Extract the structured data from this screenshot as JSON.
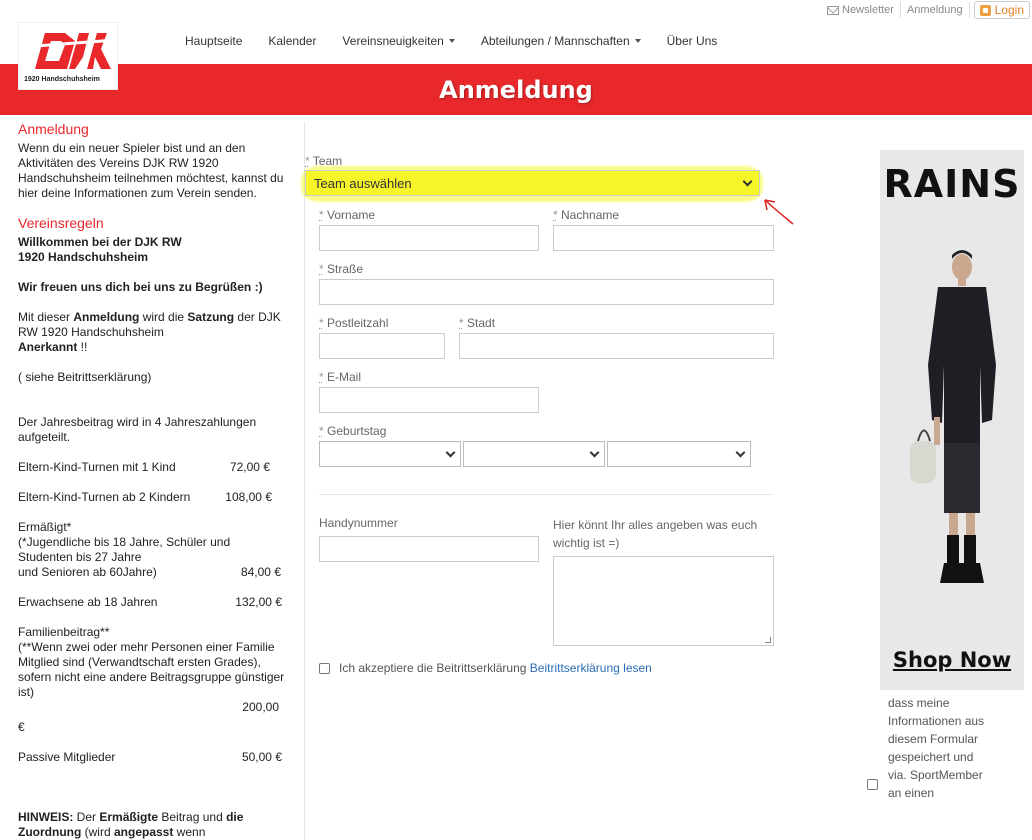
{
  "utility": {
    "newsletter": "Newsletter",
    "anmeldung": "Anmeldung",
    "login": "Login"
  },
  "logo": {
    "mark": "DJK",
    "subtitle": "1920 Handschuhsheim",
    "color": "#e8282b"
  },
  "nav": [
    {
      "label": "Hauptseite",
      "dropdown": false
    },
    {
      "label": "Kalender",
      "dropdown": false
    },
    {
      "label": "Vereinsneuigkeiten",
      "dropdown": true
    },
    {
      "label": "Abteilungen / Mannschaften",
      "dropdown": true
    },
    {
      "label": "Über Uns",
      "dropdown": false
    }
  ],
  "banner": {
    "title": "Anmeldung",
    "color": "#e8282b"
  },
  "left": {
    "heading1": "Anmeldung",
    "intro": "Wenn du ein neuer Spieler bist und an den Aktivitäten des Vereins DJK RW 1920 Handschuhsheim teilnehmen möchtest, kannst du hier deine Informationen zum Verein senden.",
    "heading2": "Vereinsregeln",
    "welcome": "Willkommen bei der DJK RW 1920 Handschuhsheim",
    "greeting": "Wir freuen uns dich bei uns zu Begrüßen :)",
    "rules_pre": "Mit dieser ",
    "rules_b1": "Anmeldung",
    "rules_mid": " wird die ",
    "rules_b2": "Satzung",
    "rules_post": " der DJK RW 1920 Handschuhsheim",
    "rules_b3": "Anerkannt",
    "rules_end": " !!",
    "note": "( siehe Beitrittserklärung)",
    "fee_intro": "Der Jahresbeitrag wird in 4 Jahreszahlungen aufgeteilt.",
    "fee1_label": "Eltern-Kind-Turnen mit 1 Kind",
    "fee1_value": "72,00 €",
    "fee2_label": "Eltern-Kind-Turnen ab 2 Kindern",
    "fee2_value": "108,00 €",
    "fee3_title": "Ermäßigt*",
    "fee3_desc": "(*Jugendliche bis 18 Jahre, Schüler und Studenten bis 27 Jahre",
    "fee3_label": "und Senioren ab 60Jahre)",
    "fee3_value": "84,00 €",
    "fee4_label": "Erwachsene ab 18 Jahren",
    "fee4_value": "132,00 €",
    "fee5_title": "Familienbeitrag**",
    "fee5_desc": "(**Wenn zwei oder mehr Personen einer Familie Mitglied sind (Verwandtschaft ersten Grades), sofern nicht eine andere Beitragsgruppe günstiger ist)",
    "fee5_value": "200,00",
    "fee5_currency": "€",
    "fee6_label": "Passive Mitglieder",
    "fee6_value": "50,00 €",
    "hinweis_b": "HINWEIS:",
    "hinweis_1": " Der ",
    "hinweis_b2": "Ermäßigte",
    "hinweis_2": " Beitrag und ",
    "hinweis_b3": "die",
    "hinweis_b4": "Zuordnung",
    "hinweis_3": " (wird ",
    "hinweis_b5": "angepasst",
    "hinweis_4": " wenn"
  },
  "form": {
    "req": "*",
    "team_label": "Team",
    "team_value": "Team auswählen",
    "vorname": "Vorname",
    "nachname": "Nachname",
    "strasse": "Straße",
    "plz": "Postleitzahl",
    "stadt": "Stadt",
    "email": "E-Mail",
    "geburtstag": "Geburtstag",
    "handy": "Handynummer",
    "notes": "Hier könnt Ihr alles angeben was euch wichtig ist =)",
    "accept_text": "Ich akzeptiere die Beitrittserklärung",
    "accept_link": "Beitrittserklärung lesen",
    "highlight_color": "#f5f52a",
    "link_color": "#2a6db5"
  },
  "ad": {
    "brand": "RAINS",
    "cta": "Shop Now"
  },
  "right_text": "dass meine Informationen aus diesem Formular gespeichert und via. SportMember an einen"
}
